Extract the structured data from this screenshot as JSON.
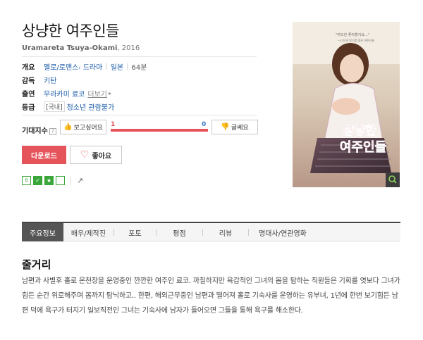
{
  "movie": {
    "title": "상냥한 여주인들",
    "original_title": "Uramareta Tsuya-Okami",
    "year": "2016"
  },
  "info": {
    "overview_label": "개요",
    "genre1": "멜로/로맨스",
    "genre2": "드라마",
    "country": "일본",
    "runtime": "64분",
    "director_label": "감독",
    "director": "키탄",
    "cast_label": "출연",
    "cast": "무라카미 료코",
    "more_label": "더보기",
    "rating_label": "등급",
    "rating_region": "[국내]",
    "rating_value": "청소년 관람불가"
  },
  "expectation": {
    "label": "기대지수",
    "want_label": "보고싶어요",
    "meh_label": "글쎄요",
    "want_count": "1",
    "meh_count": "0",
    "want_fraction": 1.0
  },
  "actions": {
    "download_label": "다운로드",
    "like_label": "좋아요"
  },
  "poster": {
    "tagline": "\"여으한 좋아했거요...\" —너으의 탕기를 좋은 여주인들",
    "title_line1": "상냥한",
    "title_line2": "여주인들"
  },
  "tabs": [
    "주요정보",
    "배우/제작진",
    "포토",
    "평점",
    "리뷰",
    "명대사/연관영화"
  ],
  "synopsis": {
    "title": "줄거리",
    "body": "남편과 사별후 홀로 온천장을 운영중인 깐깐한 여주인 료코. 까칠하지만 육감적인 그녀의 몸을 탐하는 직원들은 기회를 엿보다 그녀가 힘든 순간 위로해주며 몸까지 탐닉하고.. 한편, 해외근무중인 남편과 떨어져 홀로 기숙사를 운영하는 유부녀, 1년에 한번 보기힘든 남편 덕에 욕구가 터지기 일보직전인 그녀는 기숙사에 남자가 들어오면 그들을 통해 욕구를 해소한다."
  },
  "colors": {
    "accent": "#e5545a",
    "link": "#1a5aa8",
    "green": "#3aa63a"
  }
}
